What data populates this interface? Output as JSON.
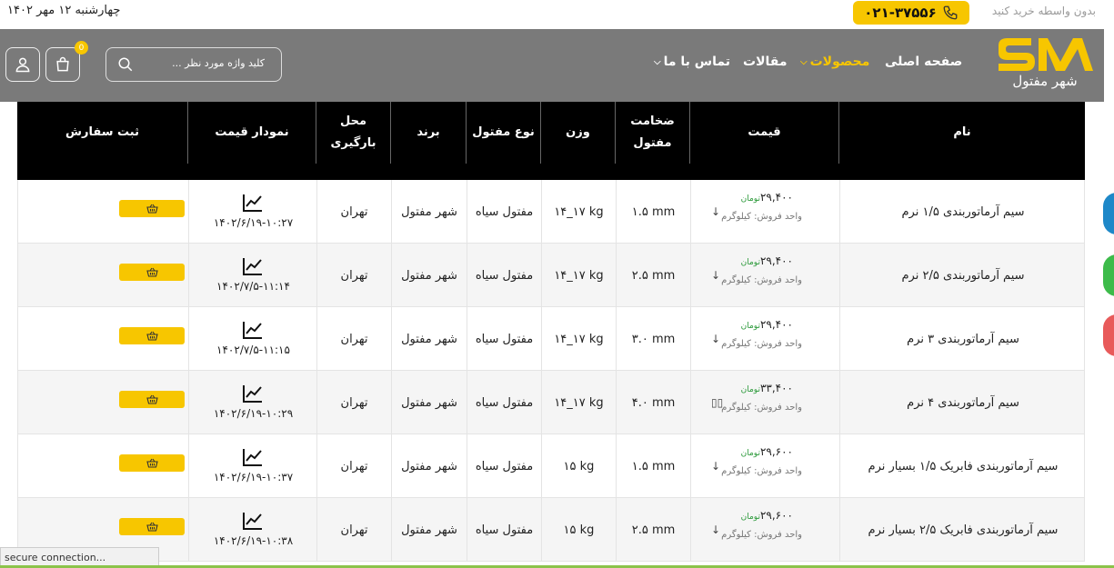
{
  "topbar": {
    "date": "چهارشنبه ۱۲ مهر ۱۴۰۲",
    "buy_text": "بدون واسطه خرید کنید",
    "phone": "۰۲۱-۳۷۵۵۶"
  },
  "header": {
    "cart_count": "0",
    "search_placeholder": "کلید واژه مورد نظر ...",
    "nav": {
      "home": "صفحه اصلی",
      "products": "محصولات",
      "articles": "مقالات",
      "contact": "تماس با ما"
    },
    "logo_text": "شهر مفتول"
  },
  "table": {
    "headers": {
      "name": "نام",
      "price": "قیمت",
      "thickness_1": "ضخامت",
      "thickness_2": "مفتول",
      "weight": "وزن",
      "type": "نوع مفتول",
      "brand": "برند",
      "location": "محل بارگیری",
      "chart": "نمودار قیمت",
      "order": "ثبت سفارش"
    },
    "rows": [
      {
        "name": "سیم آرماتوربندی ۱/۵ نرم",
        "price": "۲۹,۴۰۰",
        "currency": "تومان",
        "unit": "واحد فروش: کیلوگرم",
        "trend": "↓",
        "thickness": "۱.۵ mm",
        "weight": "۱۴_۱۷ kg",
        "type": "مفتول سیاه",
        "brand": "شهر مفتول",
        "location": "تهران",
        "date": "۱۴۰۲/۶/۱۹-۱۰:۲۷"
      },
      {
        "name": "سیم آرماتوربندی ۲/۵ نرم",
        "price": "۲۹,۴۰۰",
        "currency": "تومان",
        "unit": "واحد فروش: کیلوگرم",
        "trend": "↓",
        "thickness": "۲.۵ mm",
        "weight": "۱۴_۱۷ kg",
        "type": "مفتول سیاه",
        "brand": "شهر مفتول",
        "location": "تهران",
        "date": "۱۴۰۲/۷/۵-۱۱:۱۴"
      },
      {
        "name": "سیم آرماتوربندی ۳ نرم",
        "price": "۲۹,۴۰۰",
        "currency": "تومان",
        "unit": "واحد فروش: کیلوگرم",
        "trend": "↓",
        "thickness": "۳.۰ mm",
        "weight": "۱۴_۱۷ kg",
        "type": "مفتول سیاه",
        "brand": "شهر مفتول",
        "location": "تهران",
        "date": "۱۴۰۲/۷/۵-۱۱:۱۵"
      },
      {
        "name": "سیم آرماتوربندی ۴ نرم",
        "price": "۳۳,۴۰۰",
        "currency": "تومان",
        "unit": "واحد فروش: کیلوگرم",
        "trend": "▯▯",
        "thickness": "۴.۰ mm",
        "weight": "۱۴_۱۷ kg",
        "type": "مفتول سیاه",
        "brand": "شهر مفتول",
        "location": "تهران",
        "date": "۱۴۰۲/۶/۱۹-۱۰:۲۹"
      },
      {
        "name": "سیم آرماتوربندی فابریک ۱/۵ بسیار نرم",
        "price": "۲۹,۶۰۰",
        "currency": "تومان",
        "unit": "واحد فروش: کیلوگرم",
        "trend": "↓",
        "thickness": "۱.۵ mm",
        "weight": "۱۵ kg",
        "type": "مفتول سیاه",
        "brand": "شهر مفتول",
        "location": "تهران",
        "date": "۱۴۰۲/۶/۱۹-۱۰:۳۷"
      },
      {
        "name": "سیم آرماتوربندی فابریک ۲/۵ بسیار نرم",
        "price": "۲۹,۶۰۰",
        "currency": "تومان",
        "unit": "واحد فروش: کیلوگرم",
        "trend": "↓",
        "thickness": "۲.۵ mm",
        "weight": "۱۵ kg",
        "type": "مفتول سیاه",
        "brand": "شهر مفتول",
        "location": "تهران",
        "date": "۱۴۰۲/۶/۱۹-۱۰:۳۸"
      }
    ]
  },
  "status": "secure connection...",
  "colors": {
    "accent": "#f7c600",
    "header_bg": "#7a7a7a",
    "table_head_bg": "#000000",
    "price_currency": "#2c9a3b",
    "side_blue": "#1e88c8",
    "side_green": "#3dbb4a",
    "side_red": "#e85a5a"
  },
  "icons": [
    "phone-icon",
    "user-icon",
    "cart-icon",
    "search-icon",
    "chevron-down-icon",
    "line-chart-icon",
    "basket-icon",
    "arrow-down-icon"
  ]
}
